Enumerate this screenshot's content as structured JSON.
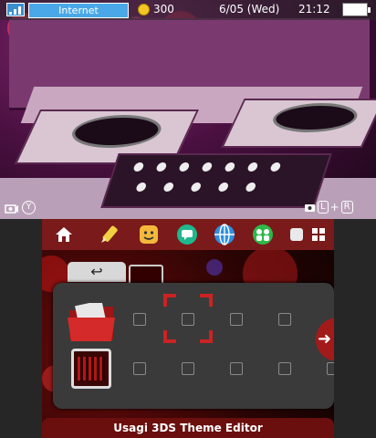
{
  "status_bar": {
    "network": "Internet",
    "coins": "300",
    "date": "6/05 (Wed)",
    "time": "21:12",
    "icons": [
      "wifi-signal-icon",
      "coin-icon",
      "battery-icon"
    ]
  },
  "camera_hints": {
    "left_button": "Y",
    "right_buttons": [
      "L",
      "+",
      "R"
    ]
  },
  "home_menu": {
    "back_label": "↩",
    "top_icons": [
      "settings-icon",
      "pencil-icon",
      "face-icon",
      "chat-icon",
      "globe-icon",
      "people-icon",
      "brightness-icon",
      "grid-icon"
    ],
    "next_arrow": "➜"
  },
  "footer": {
    "title": "Usagi 3DS Theme Editor"
  },
  "colors": {
    "accent_red": "#a31a1a",
    "status_blue": "#4aa8e8",
    "tray_gray": "#3a3a3a"
  }
}
